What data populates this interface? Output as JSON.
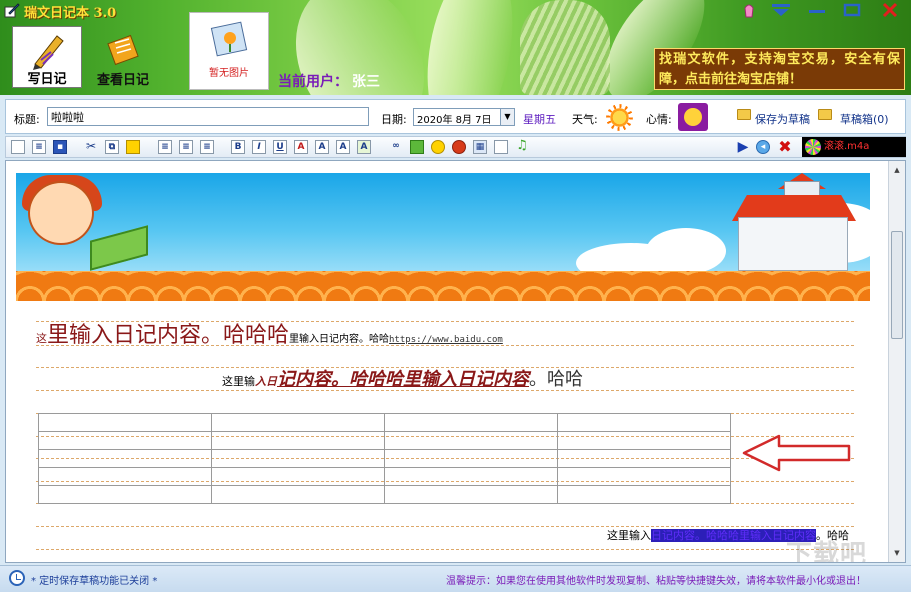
{
  "app": {
    "title": "瑞文日记本 3.0"
  },
  "header": {
    "write_label": "写日记",
    "view_label": "查看日记",
    "photo_label": "暂无图片",
    "current_user_label": "当前用户：",
    "current_user_name": "张三",
    "promo_text": "找瑞文软件，支持淘宝交易，安全有保障，点击前往淘宝店铺！"
  },
  "form": {
    "title_label": "标题:",
    "title_value": "啦啦啦",
    "date_label": "日期:",
    "date_value": "2020年 8月 7日",
    "weekday": "星期五",
    "weather_label": "天气:",
    "mood_label": "心情:",
    "save_draft": "保存为草稿",
    "draft_box": "草稿箱(0)"
  },
  "toolbar": {
    "music_label": "滚滚.m4a"
  },
  "editor": {
    "line1": {
      "a": "这",
      "b": "里输入日记内容。哈哈哈",
      "c": "里输入日记内容。哈哈",
      "url": "https://www.baidu.com"
    },
    "line2": {
      "a": "这里输",
      "b": "入日",
      "c": "记内容。哈哈哈里输入日记内容",
      "d": "。哈哈"
    },
    "line3": {
      "a": "这里输入",
      "sel": "日记内容。哈哈哈里输入日记内容",
      "b": "。哈哈"
    },
    "table": {
      "rows": 5,
      "cols": 4
    }
  },
  "status": {
    "left": "* 定时保存草稿功能已关闭 *",
    "right": "温馨提示：如果您在使用其他软件时发现复制、粘贴等快捷键失效，请将本软件最小化或退出！"
  },
  "watermark": "下载吧",
  "colors": {
    "accent": "#7a1cb8",
    "banner_sky": "#1aa6e8",
    "promo_bg": "#7a3a06",
    "dashed_line": "#dda86a"
  }
}
